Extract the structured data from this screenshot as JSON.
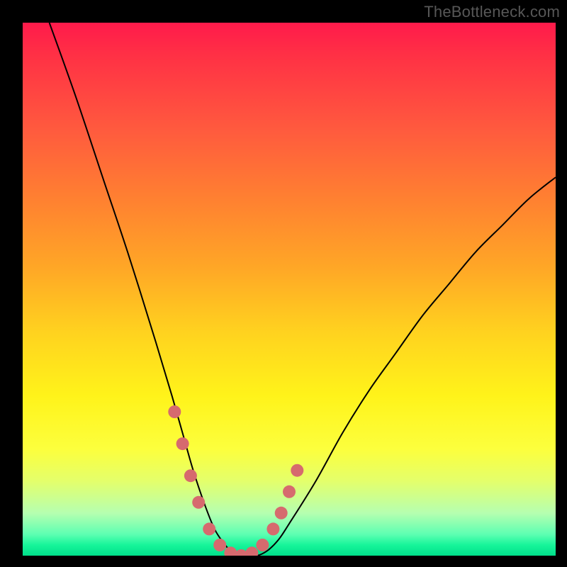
{
  "attribution": "TheBottleneck.com",
  "chart_data": {
    "type": "line",
    "title": "",
    "xlabel": "",
    "ylabel": "",
    "xlim": [
      0,
      100
    ],
    "ylim": [
      0,
      100
    ],
    "grid": false,
    "legend": false,
    "background": "rainbow-gradient-vertical",
    "series": [
      {
        "name": "bottleneck-curve",
        "x": [
          5,
          10,
          15,
          20,
          25,
          28,
          30,
          32,
          34,
          36,
          38,
          40,
          42,
          44,
          46,
          48,
          50,
          55,
          60,
          65,
          70,
          75,
          80,
          85,
          90,
          95,
          100
        ],
        "y": [
          100,
          86,
          71,
          56,
          40,
          30,
          23,
          16,
          10,
          5,
          2,
          0,
          0,
          0,
          1,
          3,
          6,
          14,
          23,
          31,
          38,
          45,
          51,
          57,
          62,
          67,
          71
        ]
      }
    ],
    "markers": [
      {
        "x": 28.5,
        "y": 27
      },
      {
        "x": 30.0,
        "y": 21
      },
      {
        "x": 31.5,
        "y": 15
      },
      {
        "x": 33.0,
        "y": 10
      },
      {
        "x": 35.0,
        "y": 5
      },
      {
        "x": 37.0,
        "y": 2
      },
      {
        "x": 39.0,
        "y": 0.5
      },
      {
        "x": 41.0,
        "y": 0
      },
      {
        "x": 43.0,
        "y": 0.5
      },
      {
        "x": 45.0,
        "y": 2
      },
      {
        "x": 47.0,
        "y": 5
      },
      {
        "x": 48.5,
        "y": 8
      },
      {
        "x": 50.0,
        "y": 12
      },
      {
        "x": 51.5,
        "y": 16
      }
    ],
    "marker_color": "#d66a6e",
    "marker_radius_px": 9,
    "gradient_stops": [
      {
        "pos": 0.0,
        "color": "#ff1a4b"
      },
      {
        "pos": 0.2,
        "color": "#ff5a3e"
      },
      {
        "pos": 0.46,
        "color": "#ffa726"
      },
      {
        "pos": 0.7,
        "color": "#fff31a"
      },
      {
        "pos": 0.92,
        "color": "#b6ffb0"
      },
      {
        "pos": 1.0,
        "color": "#00df8a"
      }
    ]
  }
}
